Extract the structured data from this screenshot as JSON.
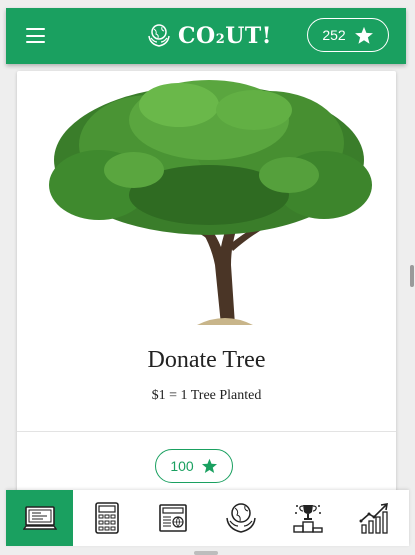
{
  "header": {
    "app_name_main": "CO",
    "app_name_sub": "2",
    "app_name_tail": "UT!",
    "points": "252",
    "menu_icon": "hamburger-menu-icon",
    "logo_icon": "globe-hands-icon",
    "points_icon": "star-icon"
  },
  "card": {
    "title": "Donate Tree",
    "subtitle": "$1 = 1 Tree Planted",
    "cost": "100",
    "cost_icon": "star-icon",
    "image": "tree-image"
  },
  "nav": {
    "items": [
      {
        "icon": "computer-icon",
        "active": true
      },
      {
        "icon": "calculator-icon",
        "active": false
      },
      {
        "icon": "news-icon",
        "active": false
      },
      {
        "icon": "globe-hands-icon",
        "active": false
      },
      {
        "icon": "trophy-podium-icon",
        "active": false
      },
      {
        "icon": "growth-chart-icon",
        "active": false
      }
    ]
  },
  "colors": {
    "brand_green": "#1aa060",
    "white": "#ffffff",
    "text_dark": "#222222"
  }
}
